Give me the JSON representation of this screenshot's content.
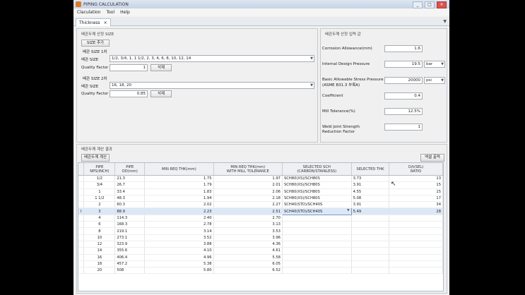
{
  "window": {
    "title": "PIPING CALCULATION",
    "buttons": [
      "_",
      "□",
      "×"
    ]
  },
  "menu": [
    "Claculation",
    "Tool",
    "Help"
  ],
  "tab": {
    "label": "Thickness",
    "close": "×",
    "arrow": "▼"
  },
  "size_input": {
    "title": "배관두께 산정 SIZE",
    "add_button": "SIZE 추가",
    "group1": {
      "title": "배관 SIZE 1차",
      "size_label": "배관 SIZE",
      "size_value": "1/2, 3/4, 1, 1 1/2, 2, 3, 4, 6, 8, 10, 12, 14",
      "qf_label": "Quality Factor",
      "qf_value": "1",
      "delete_button": "삭제"
    },
    "group2": {
      "title": "배관 SIZE 2차",
      "size_label": "배관 SIZE",
      "size_value": "16, 18, 20",
      "qf_label": "Quality Factor",
      "qf_value": "0.85",
      "delete_button": "삭제"
    }
  },
  "conditions": {
    "title": "배관두께 산정 입력 값",
    "corrosion": {
      "label": "Corrosion Allowance(mm)",
      "value": "1.6"
    },
    "pressure": {
      "label": "Internal Design Pressure",
      "value": "19.5",
      "unit": "bar"
    },
    "stress": {
      "label1": "Basic Allowable Stress Pressure",
      "label2": "(ASME B31.3 부록A)",
      "value": "20000",
      "unit": "psi"
    },
    "coefficient": {
      "label": "Coefficient",
      "value": "0.4"
    },
    "mill": {
      "label": "Mill Tolerance(%)",
      "value": "12.5%"
    },
    "weld": {
      "label1": "Weld Joint Strength",
      "label2": "Reduction Factor",
      "value": "1"
    }
  },
  "result": {
    "title": "배관두께 계산 결과",
    "calc_button": "배관두께 계산",
    "excel_button": "엑셀 출력",
    "columns": [
      "",
      "PIPE\nNPS(INCH)",
      "PIPE\nOD(mm)",
      "MIN REQ THK(mm)",
      "MIN REQ THK(mm)\nWITH MILL TOLERANCE",
      "SELECTED SCH\n(CARBON/STAINLESS)",
      "SELECTED THK",
      "D/t(SEL)\nRATIO"
    ],
    "rows": [
      {
        "m": "",
        "nps": "1/2",
        "od": "21.3",
        "thk": "1.75",
        "thkm": "1.97",
        "sch": "SCH80(XS)/SCH80S",
        "sthk": "3.73",
        "ratio": "13"
      },
      {
        "m": "",
        "nps": "3/4",
        "od": "26.7",
        "thk": "1.79",
        "thkm": "2.01",
        "sch": "SCH80(XS)/SCH80S",
        "sthk": "3.91",
        "ratio": "15"
      },
      {
        "m": "",
        "nps": "1",
        "od": "33.4",
        "thk": "1.83",
        "thkm": "2.06",
        "sch": "SCH80(XS)/SCH80S",
        "sthk": "4.55",
        "ratio": "15"
      },
      {
        "m": "",
        "nps": "1 1/2",
        "od": "48.3",
        "thk": "1.94",
        "thkm": "2.18",
        "sch": "SCH80(XS)/SCH80S",
        "sthk": "5.08",
        "ratio": "17"
      },
      {
        "m": "",
        "nps": "2",
        "od": "60.3",
        "thk": "2.02",
        "thkm": "2.27",
        "sch": "SCH40(STD)/SCH40S",
        "sthk": "3.91",
        "ratio": "34"
      },
      {
        "m": "I",
        "nps": "3",
        "od": "88.9",
        "thk": "2.23",
        "thkm": "2.51",
        "sch": "SCH40(STD)/SCH40S",
        "sthk": "5.49",
        "ratio": "28",
        "selected": true
      },
      {
        "m": "",
        "nps": "4",
        "od": "114.3",
        "thk": "2.40",
        "thkm": "2.70",
        "sch": "",
        "sthk": "",
        "ratio": ""
      },
      {
        "m": "",
        "nps": "6",
        "od": "168.3",
        "thk": "2.78",
        "thkm": "3.13",
        "sch": "",
        "sthk": "",
        "ratio": ""
      },
      {
        "m": "",
        "nps": "8",
        "od": "219.1",
        "thk": "3.14",
        "thkm": "3.53",
        "sch": "",
        "sthk": "",
        "ratio": ""
      },
      {
        "m": "",
        "nps": "10",
        "od": "273.1",
        "thk": "3.52",
        "thkm": "3.96",
        "sch": "",
        "sthk": "",
        "ratio": ""
      },
      {
        "m": "",
        "nps": "12",
        "od": "323.9",
        "thk": "3.88",
        "thkm": "4.36",
        "sch": "",
        "sthk": "",
        "ratio": ""
      },
      {
        "m": "",
        "nps": "14",
        "od": "355.6",
        "thk": "4.10",
        "thkm": "4.61",
        "sch": "",
        "sthk": "",
        "ratio": ""
      },
      {
        "m": "",
        "nps": "16",
        "od": "406.4",
        "thk": "4.96",
        "thkm": "5.58",
        "sch": "",
        "sthk": "",
        "ratio": ""
      },
      {
        "m": "",
        "nps": "18",
        "od": "457.2",
        "thk": "5.38",
        "thkm": "6.05",
        "sch": "",
        "sthk": "",
        "ratio": ""
      },
      {
        "m": "",
        "nps": "20",
        "od": "508",
        "thk": "5.80",
        "thkm": "6.52",
        "sch": "",
        "sthk": "",
        "ratio": ""
      }
    ]
  },
  "icons": {
    "dropdown": "chevron-down-icon",
    "app": "app-icon",
    "cursor": "mouse-cursor-icon"
  }
}
